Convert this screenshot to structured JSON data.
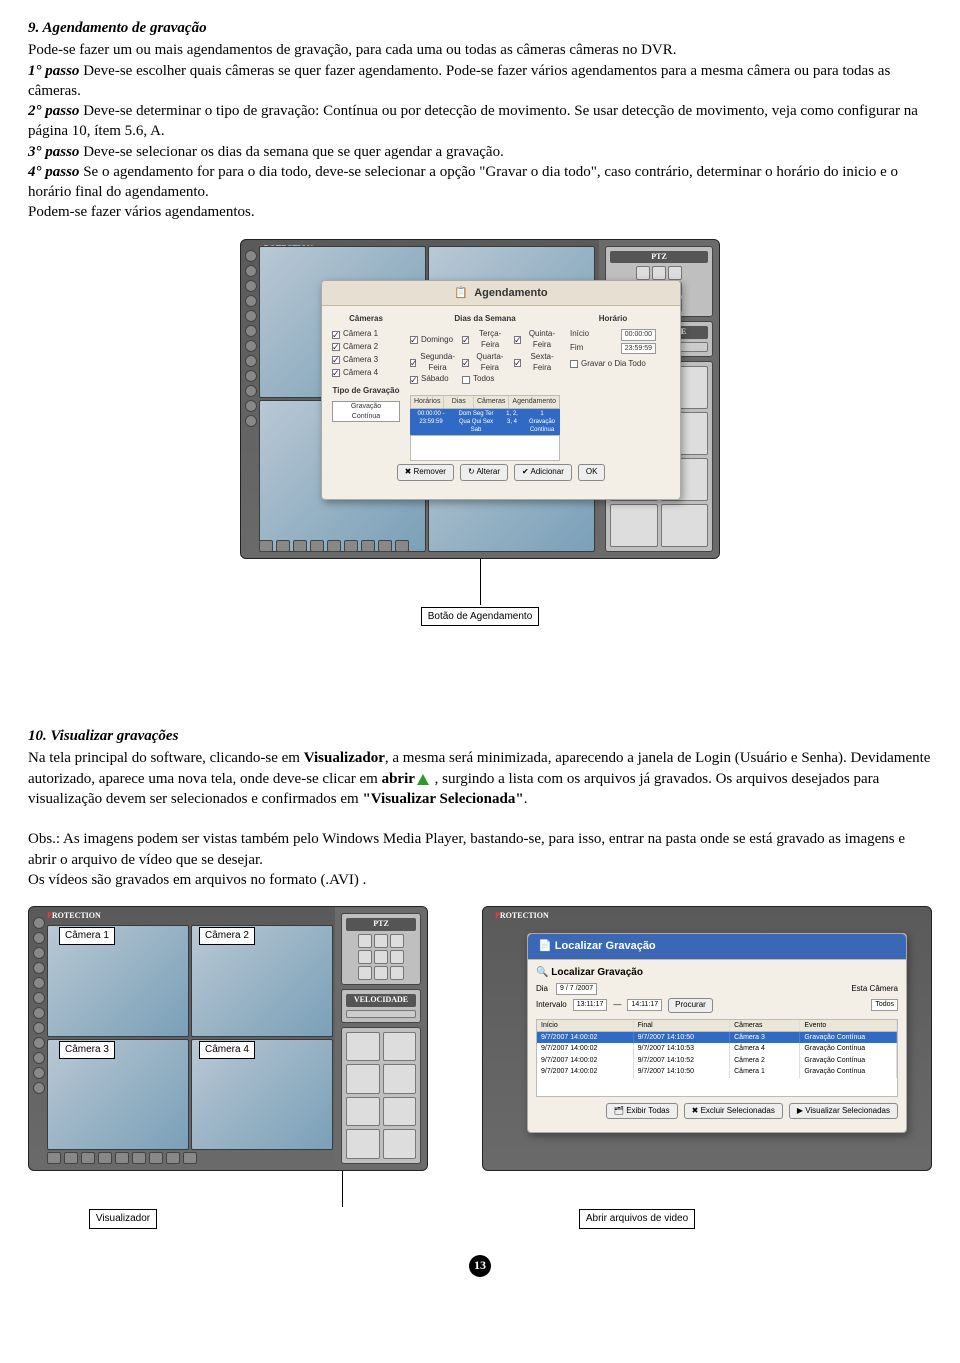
{
  "s9": {
    "title": "9. Agendamento de gravação",
    "p1": "Pode-se  fazer um ou mais agendamentos de gravação, para cada uma ou todas as câmeras câmeras no DVR.",
    "step1_label": "1° passo",
    "step1": " Deve-se escolher quais câmeras se quer fazer agendamento. Pode-se fazer vários agendamentos para a mesma câmera ou para todas as câmeras.",
    "step2_label": "2° passo",
    "step2": " Deve-se determinar o tipo de gravação: Contínua ou por detecção de movimento. Se usar detecção de movimento, veja como configurar na página 10, ítem 5.6, A.",
    "step3_label": "3° passo",
    "step3": " Deve-se selecionar os dias da semana que se quer agendar a gravação.",
    "step4_label": "4° passo",
    "step4": " Se o agendamento for para o dia todo, deve-se selecionar a opção \"Gravar o dia todo\", caso contrário, determinar o horário do inicio e o horário final do agendamento.",
    "p5": "Podem-se fazer vários agendamentos."
  },
  "dlg": {
    "title": "Agendamento",
    "cam_title": "Câmeras",
    "cams": [
      "Câmera 1",
      "Câmera 2",
      "Câmera 3",
      "Câmera 4"
    ],
    "hora_title": "Horário",
    "inicio": "Início",
    "inicio_val": "00:00:00",
    "fim": "Fim",
    "fim_val": "23:59:59",
    "gravar_dia": "Gravar o Dia Todo",
    "tipo_title": "Tipo de Gravação",
    "tipo_val": "Gravação Contínua",
    "dias_title": "Dias da Semana",
    "dias": [
      "Domingo",
      "Segunda-Feira",
      "Terça-Feira",
      "Quarta-Feira",
      "Quinta-Feira",
      "Sexta-Feira",
      "Sábado",
      "Todos"
    ],
    "grid_h1": "Horários",
    "grid_h2": "Dias",
    "grid_h3": "Câmeras",
    "grid_h4": "Agendamento",
    "grid_r1": "00:00:00 - 23:59:59",
    "grid_r2": "Dom Seg Ter Qua Qui Sex Sab",
    "grid_r3": "1, 2, 3, 4",
    "grid_r4": "1 Gravação Contínua",
    "btn_remover": "Remover",
    "btn_alterar": "Alterar",
    "btn_adicionar": "Adicionar",
    "btn_ok": "OK"
  },
  "brand_p": "P",
  "brand_rest": "ROTECTION",
  "ptz_title": "PTZ",
  "vel_title": "VELOCIDADE",
  "callout1": "Botão de Agendamento",
  "s10": {
    "title": "10. Visualizar gravações",
    "p1a": "Na tela principal do software, clicando-se em ",
    "p1b": "Visualizador",
    "p1c": ", a mesma será minimizada, aparecendo a janela de Login (Usuário e Senha). Devidamente autorizado, aparece uma nova tela, onde deve-se clicar em ",
    "p1d": "abrir",
    "p1e": " , surgindo a lista com os arquivos já gravados. Os arquivos desejados para visualização devem ser selecionados e confirmados em ",
    "p1f": "\"Visualizar Selecionada\"",
    "p1g": ".",
    "obs": "Obs.: As imagens podem ser vistas também pelo Windows Media Player, bastando-se, para isso, entrar na pasta onde se está gravado as imagens e abrir o arquivo de vídeo que se desejar.",
    "p3": "Os vídeos são gravados em arquivos no formato (.AVI) ."
  },
  "cam_labels": {
    "c1": "Câmera 1",
    "c2": "Câmera 2",
    "c3": "Câmera 3",
    "c4": "Câmera 4"
  },
  "callout2": "Visualizador",
  "callout3": "Abrir arquivos de video",
  "dlg2": {
    "title": "Localizar Gravação",
    "dia": "Dia",
    "dia_val": "9 / 7 /2007",
    "intervalo": "Intervalo",
    "int1": "13:11:17",
    "int2": "14:11:17",
    "procurar": "Procurar",
    "esta": "Esta Câmera",
    "todos": "Todos",
    "h1": "Início",
    "h2": "Final",
    "h3": "Câmeras",
    "h4": "Evento",
    "rows": [
      [
        "9/7/2007 14:00:02",
        "9/7/2007 14:10:50",
        "Câmera 3",
        "Gravação Contínua"
      ],
      [
        "9/7/2007 14:00:02",
        "9/7/2007 14:10:53",
        "Câmera 4",
        "Gravação Contínua"
      ],
      [
        "9/7/2007 14:00:02",
        "9/7/2007 14:10:52",
        "Câmera 2",
        "Gravação Contínua"
      ],
      [
        "9/7/2007 14:00:02",
        "9/7/2007 14:10:50",
        "Câmera 1",
        "Gravação Contínua"
      ]
    ],
    "btn1": "Exibir Todas",
    "btn2": "Excluir Selecionadas",
    "btn3": "Visualizar Selecionadas"
  },
  "page_num": "13"
}
